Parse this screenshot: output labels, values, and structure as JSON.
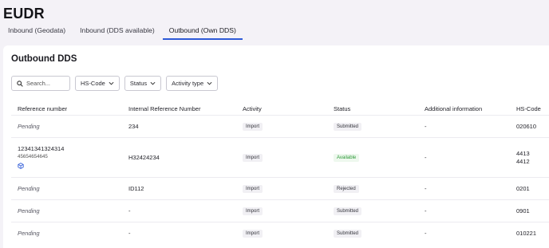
{
  "app": {
    "title": "EUDR"
  },
  "tabs": [
    {
      "label": "Inbound (Geodata)"
    },
    {
      "label": "Inbound (DDS available)"
    },
    {
      "label": "Outbound (Own DDS)"
    }
  ],
  "section": {
    "title": "Outbound DDS"
  },
  "filters": {
    "search_placeholder": "Search...",
    "hs_code": "HS-Code",
    "status": "Status",
    "activity_type": "Activity type"
  },
  "table": {
    "columns": [
      "Reference number",
      "Internal Reference Number",
      "Activity",
      "Status",
      "Additional information",
      "HS-Code"
    ],
    "rows": [
      {
        "reference": "Pending",
        "sub_reference": "",
        "internal": "234",
        "activity": "Import",
        "status": "Submitted",
        "additional": "-",
        "hs": [
          "020610"
        ]
      },
      {
        "reference": "12341341324314",
        "sub_reference": "45654654645",
        "internal": "H32424234",
        "activity": "Import",
        "status": "Available",
        "additional": "-",
        "hs": [
          "4413",
          "4412"
        ]
      },
      {
        "reference": "Pending",
        "sub_reference": "",
        "internal": "ID112",
        "activity": "Import",
        "status": "Rejected",
        "additional": "-",
        "hs": [
          "0201"
        ]
      },
      {
        "reference": "Pending",
        "sub_reference": "",
        "internal": "-",
        "activity": "Import",
        "status": "Submitted",
        "additional": "-",
        "hs": [
          "0901"
        ]
      },
      {
        "reference": "Pending",
        "sub_reference": "",
        "internal": "-",
        "activity": "Import",
        "status": "Submitted",
        "additional": "-",
        "hs": [
          "010221"
        ]
      }
    ]
  },
  "colors": {
    "accent": "#2e5ad7",
    "available": "#2f9a3a",
    "background": "#f4f2f7"
  },
  "icons": {
    "search": "search-icon",
    "chevron": "chevron-down-icon",
    "cube": "cube-icon"
  }
}
